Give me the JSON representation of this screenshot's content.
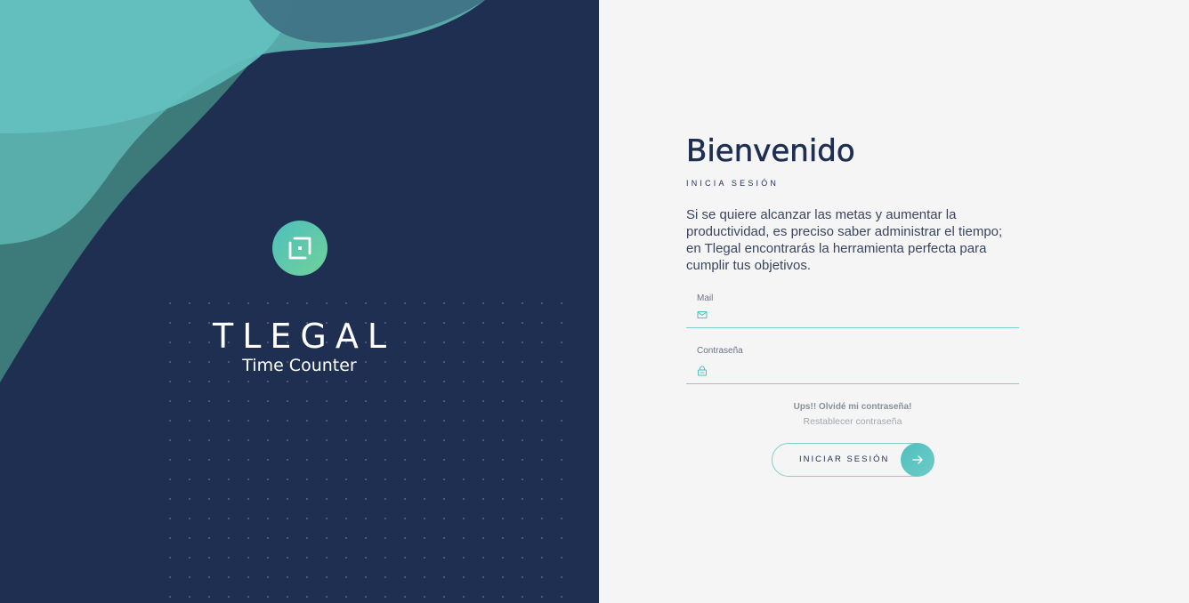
{
  "brand": {
    "name": "TLEGAL",
    "subtitle": "Time Counter",
    "logo_icon": "tlegal-logo-icon",
    "colors": {
      "navy": "#1f2f52",
      "teal": "#4ec0bd",
      "green": "#71d19a"
    }
  },
  "login": {
    "title": "Bienvenido",
    "subtitle": "INICIA SESIÓN",
    "description": "Si se quiere alcanzar las metas  y aumentar la productividad, es preciso saber administrar el tiempo; en Tlegal encontrarás la herramienta perfecta para cumplir tus objetivos.",
    "fields": [
      {
        "label": "Mail",
        "icon": "mail-icon",
        "value": "",
        "placeholder": ""
      },
      {
        "label": "Contraseña",
        "icon": "lock-icon",
        "value": "",
        "placeholder": ""
      }
    ],
    "forgot_title": "Ups!! Olvidé mi contraseña!",
    "forgot_link": "Restablecer contraseña",
    "submit_label": "INICIAR SESIÓN",
    "submit_icon": "arrow-right-icon",
    "accent_color": "#7fcfd0"
  }
}
